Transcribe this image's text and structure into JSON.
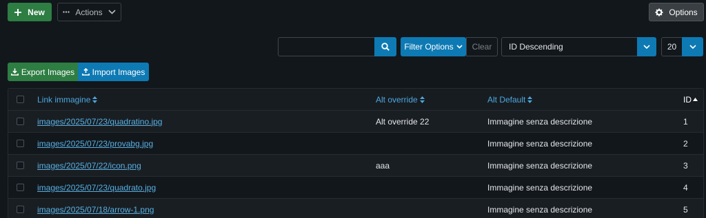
{
  "toolbar": {
    "new_label": "New",
    "actions_label": "Actions",
    "options_label": "Options"
  },
  "filters": {
    "search_value": "",
    "search_placeholder": "",
    "filter_options_label": "Filter Options",
    "clear_label": "Clear",
    "sort_selected": "ID Descending",
    "limit_selected": "20"
  },
  "io_buttons": {
    "export_label": "Export Images",
    "import_label": "Import Images"
  },
  "table": {
    "headers": {
      "link": "Link immagine",
      "alt_override": "Alt override",
      "alt_default": "Alt Default",
      "id": "ID"
    },
    "rows": [
      {
        "link": "images/2025/07/23/quadratino.jpg",
        "alt_override": "Alt override 22",
        "alt_default": "Immagine senza descrizione",
        "id": "1"
      },
      {
        "link": "images/2025/07/23/provabg.jpg",
        "alt_override": "",
        "alt_default": "Immagine senza descrizione",
        "id": "2"
      },
      {
        "link": "images/2025/07/22/icon.png",
        "alt_override": "aaa",
        "alt_default": "Immagine senza descrizione",
        "id": "3"
      },
      {
        "link": "images/2025/07/23/quadrato.jpg",
        "alt_override": "",
        "alt_default": "Immagine senza descrizione",
        "id": "4"
      },
      {
        "link": "images/2025/07/18/arrow-1.png",
        "alt_override": "",
        "alt_default": "Immagine senza descrizione",
        "id": "5"
      }
    ]
  },
  "colors": {
    "background": "#12171c",
    "success": "#2e7d43",
    "primary": "#0e7ab4",
    "link": "#58b0e2"
  }
}
